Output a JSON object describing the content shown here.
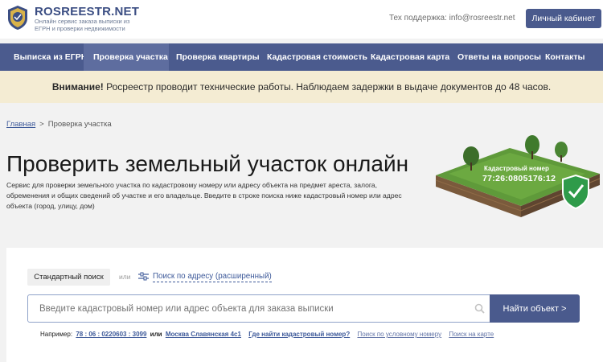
{
  "header": {
    "logo_title": "ROSREESTR.NET",
    "logo_sub": "Онлайн сервис заказа выписки из ЕГРН и проверки недвижимости",
    "support": "Тех поддержка: info@rosreestr.net",
    "cabinet_label": "Личный кабинет",
    "colors": {
      "brand": "#3b4e83",
      "button": "#4a5a8d"
    }
  },
  "nav": {
    "items": [
      {
        "label": "Выписка из ЕГРН"
      },
      {
        "label": "Проверка участка",
        "active": true
      },
      {
        "label": "Проверка квартиры"
      },
      {
        "label": "Кадастровая стоимость"
      },
      {
        "label": "Кадастровая карта"
      },
      {
        "label": "Ответы на вопросы"
      },
      {
        "label": "Контакты"
      }
    ],
    "color": "#4b5b8e"
  },
  "notice": {
    "bold": "Внимание!",
    "text": " Росреестр проводит технические работы. Наблюдаем задержки в выдаче документов до 48 часов.",
    "color": "#f4ecd3"
  },
  "breadcrumb": {
    "home": "Главная",
    "separator": ">",
    "current": "Проверка участка"
  },
  "main": {
    "title": "Проверить земельный участок онлайн",
    "description": "Сервис для проверки земельного участка по кадастровому номеру или адресу объекта на предмет ареста, залога, обременения и общих сведений об участке и его владельце. Введите в строке поиска ниже кадастровый номер или адрес объекта (город, улицу, дом)",
    "illustration": {
      "label": "Кадастровый номер",
      "number": "77:26:0805176:12",
      "icon": "shield-check-icon"
    }
  },
  "search": {
    "tab_standard": "Стандартный поиск",
    "tab_or": "или",
    "tab_advanced": "Поиск по адресу (расширенный)",
    "placeholder": "Введите кадастровый номер или адрес объекта для заказа выписки",
    "button": "Найти объект >",
    "examples": {
      "prefix": "Например:",
      "number": "78 : 06 : 0220603 : 3099",
      "or": "или",
      "address": "Москва Славянская 4с1",
      "where_link": "Где найти кадастровый номер?",
      "by_number": "Поиск по условному номеру",
      "on_map": "Поиск на карте"
    }
  }
}
